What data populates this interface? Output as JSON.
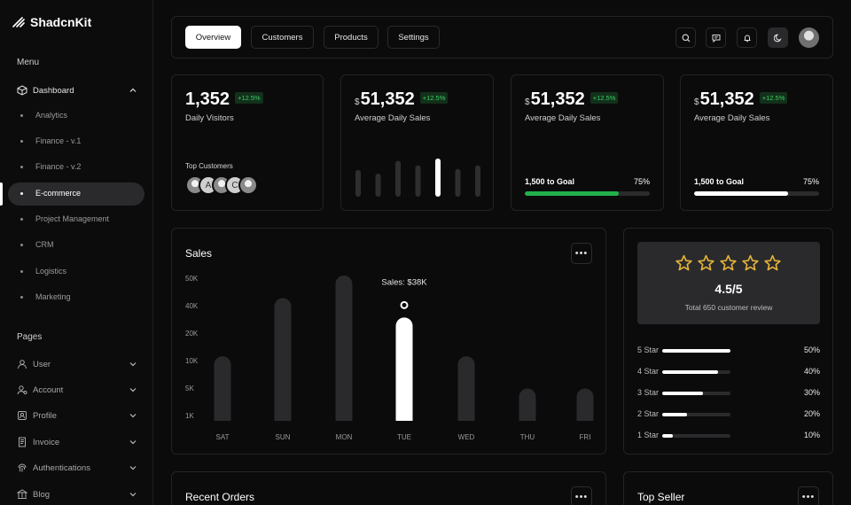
{
  "app": {
    "name": "ShadcnKit"
  },
  "sidebar": {
    "menu_title": "Menu",
    "dashboard_label": "Dashboard",
    "sub_items": [
      {
        "label": "Analytics",
        "active": false
      },
      {
        "label": "Finance - v.1",
        "active": false
      },
      {
        "label": "Finance - v.2",
        "active": false
      },
      {
        "label": "E-commerce",
        "active": true
      },
      {
        "label": "Project Management",
        "active": false
      },
      {
        "label": "CRM",
        "active": false
      },
      {
        "label": "Logistics",
        "active": false
      },
      {
        "label": "Marketing",
        "active": false
      }
    ],
    "pages_title": "Pages",
    "pages": [
      {
        "label": "User",
        "icon": "user-icon"
      },
      {
        "label": "Account",
        "icon": "account-icon"
      },
      {
        "label": "Profile",
        "icon": "profile-icon"
      },
      {
        "label": "Invoice",
        "icon": "invoice-icon"
      },
      {
        "label": "Authentications",
        "icon": "fingerprint-icon"
      },
      {
        "label": "Blog",
        "icon": "blog-icon"
      }
    ]
  },
  "topbar": {
    "tabs": [
      {
        "label": "Overview",
        "active": true
      },
      {
        "label": "Customers",
        "active": false
      },
      {
        "label": "Products",
        "active": false
      },
      {
        "label": "Settings",
        "active": false
      }
    ]
  },
  "stats": {
    "visitors": {
      "value": "1,352",
      "badge": "+12.5%",
      "label": "Daily Visitors",
      "customers_title": "Top Customers",
      "avatar_letters": [
        "A",
        "C"
      ]
    },
    "sales_bars": {
      "currency": "$",
      "value": "51,352",
      "badge": "+12.5%",
      "label": "Average Daily Sales",
      "bars": [
        0.58,
        0.5,
        0.78,
        0.68,
        0.83,
        0.6,
        0.68
      ],
      "highlight_index": 4
    },
    "sales_goal_green": {
      "currency": "$",
      "value": "51,352",
      "badge": "+12.5%",
      "label": "Average Daily Sales",
      "goal_label": "1,500 to Goal",
      "goal_pct": "75%",
      "progress": 0.75,
      "color": "#22b04b"
    },
    "sales_goal_white": {
      "currency": "$",
      "value": "51,352",
      "badge": "+12.5%",
      "label": "Average Daily Sales",
      "goal_label": "1,500 to Goal",
      "goal_pct": "75%",
      "progress": 0.75,
      "color": "#ffffff"
    }
  },
  "sales": {
    "title": "Sales",
    "tooltip": "Sales: $38K",
    "chart_data": {
      "type": "bar",
      "categories": [
        "SAT",
        "SUN",
        "MON",
        "TUE",
        "WED",
        "THU",
        "FRI"
      ],
      "values": [
        20,
        38,
        45,
        32,
        20,
        10,
        10
      ],
      "y_ticks": [
        "50K",
        "40K",
        "20K",
        "10K",
        "5K",
        "1K"
      ],
      "highlight_index": 3
    }
  },
  "reviews": {
    "rating": "4.5/5",
    "subtitle": "Total 650 customer review",
    "star_color": "#e2b23a",
    "rows": [
      {
        "label": "5 Star",
        "pct": "50%",
        "value": 1.0
      },
      {
        "label": "4 Star",
        "pct": "40%",
        "value": 0.82
      },
      {
        "label": "3 Star",
        "pct": "30%",
        "value": 0.6
      },
      {
        "label": "2 Star",
        "pct": "20%",
        "value": 0.36
      },
      {
        "label": "1 Star",
        "pct": "10%",
        "value": 0.15
      }
    ]
  },
  "recent_orders": {
    "title": "Recent Orders"
  },
  "top_seller": {
    "title": "Top Seller"
  }
}
